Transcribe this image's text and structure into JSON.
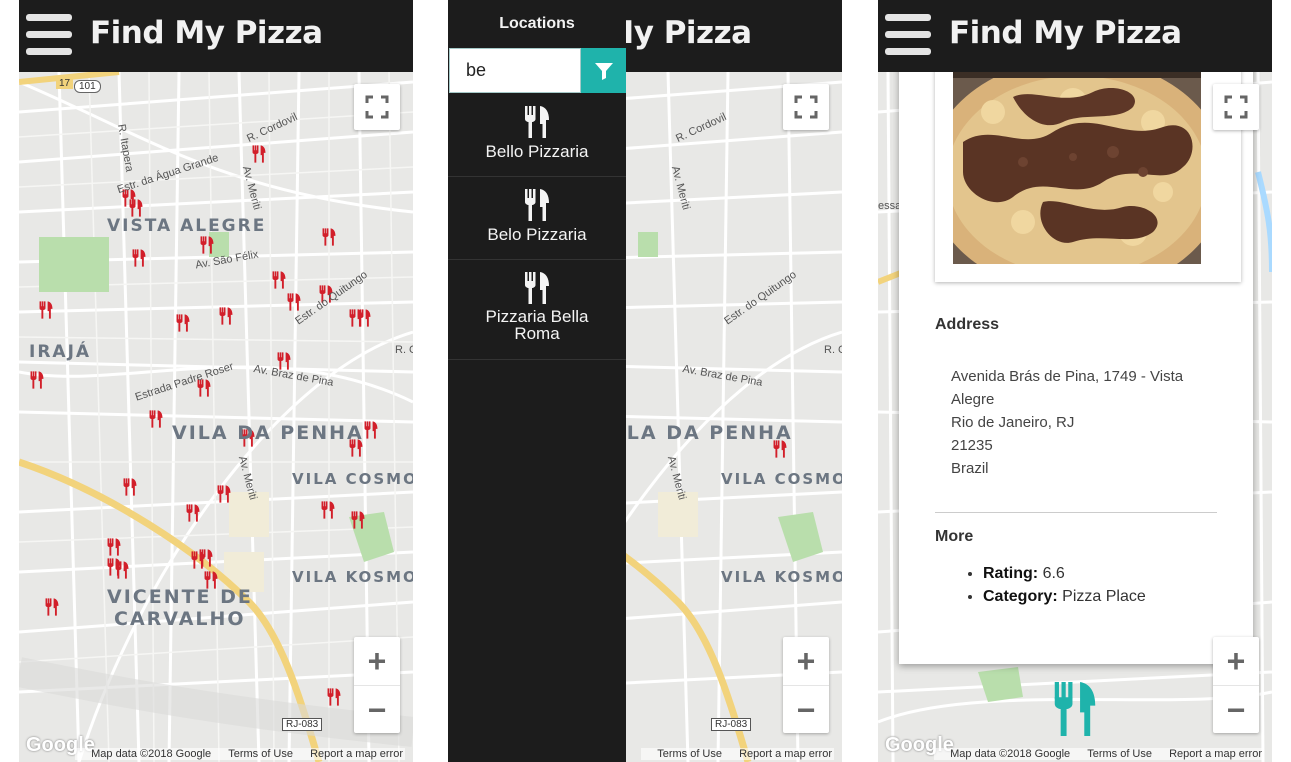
{
  "app": {
    "title": "Find My Pizza"
  },
  "map": {
    "neighborhoods": [
      "VISTA ALEGRE",
      "IRAJÁ",
      "VILA DA PENHA",
      "VILA COSMOS",
      "VILA KOSMOS",
      "VICENTE DE",
      "CARVALHO"
    ],
    "streets": [
      "R. Cordovil",
      "R. Itapera",
      "Estr. da Água Grande",
      "Av. Meriti",
      "Av. São Félix",
      "Estr. do Quitungo",
      "Estrada Padre Roser",
      "Av. Braz de Pina",
      "Av. Meriti",
      "R. C"
    ],
    "road_badges": [
      "17",
      "101",
      "RJ-083"
    ],
    "attribution": {
      "data": "Map data ©2018 Google",
      "terms": "Terms of Use",
      "report": "Report a map error"
    },
    "google_logo": "Google",
    "zoom_in": "+",
    "zoom_out": "−",
    "marker_color": "#d21f2a"
  },
  "sidebar": {
    "title": "Locations",
    "filter_value": "be",
    "filter_icon": "filter-icon",
    "accent": "#1fb3ab",
    "locations": [
      {
        "name": "Bello Pizzaria",
        "icon": "utensils-icon"
      },
      {
        "name": "Belo Pizzaria",
        "icon": "utensils-icon"
      },
      {
        "name": "Pizzaria Bella Roma",
        "icon": "utensils-icon"
      }
    ]
  },
  "infowindow": {
    "address_heading": "Address",
    "address_lines": [
      "Avenida Brás de Pina, 1749 - Vista",
      "Alegre",
      "Rio de Janeiro, RJ",
      "21235",
      "Brazil"
    ],
    "more_heading": "More",
    "rating_label": "Rating:",
    "rating_value": "6.6",
    "category_label": "Category:",
    "category_value": "Pizza Place",
    "selected_marker_color": "#1fb3ab"
  }
}
